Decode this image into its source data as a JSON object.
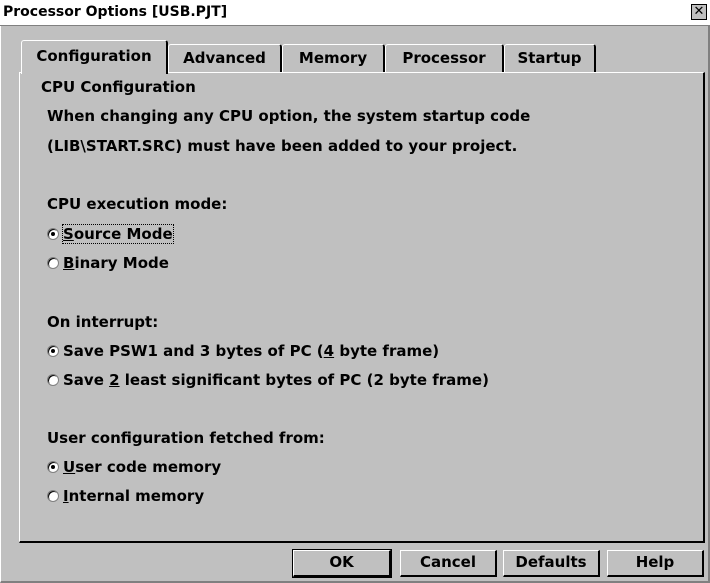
{
  "window": {
    "title": "Processor Options [USB.PJT]",
    "close_glyph": "✕"
  },
  "tabs": [
    {
      "label": "Configuration",
      "active": true
    },
    {
      "label": "Advanced",
      "active": false
    },
    {
      "label": "Memory",
      "active": false
    },
    {
      "label": "Processor",
      "active": false
    },
    {
      "label": "Startup",
      "active": false
    }
  ],
  "group": {
    "title": "CPU Configuration",
    "note_line1": "When changing any CPU option, the system startup code",
    "note_line2": "(LIB\\START.SRC) must have been added to your project."
  },
  "exec_mode": {
    "label": "CPU execution mode:",
    "options": [
      {
        "pre": "",
        "acc": "S",
        "post": "ource Mode",
        "checked": true
      },
      {
        "pre": "",
        "acc": "B",
        "post": "inary Mode",
        "checked": false
      }
    ]
  },
  "interrupt": {
    "label": "On interrupt:",
    "options": [
      {
        "pre": "Save PSW1 and 3 bytes of PC (",
        "acc": "4",
        "post": " byte frame)",
        "checked": true
      },
      {
        "pre": "Save ",
        "acc": "2",
        "post": " least significant bytes of PC (2 byte frame)",
        "checked": false
      }
    ]
  },
  "user_config": {
    "label": "User configuration fetched from:",
    "options": [
      {
        "pre": "",
        "acc": "U",
        "post": "ser code memory",
        "checked": true
      },
      {
        "pre": "",
        "acc": "I",
        "post": "nternal memory",
        "checked": false
      }
    ]
  },
  "buttons": {
    "ok": "OK",
    "cancel": "Cancel",
    "defaults": "Defaults",
    "help": "Help"
  }
}
